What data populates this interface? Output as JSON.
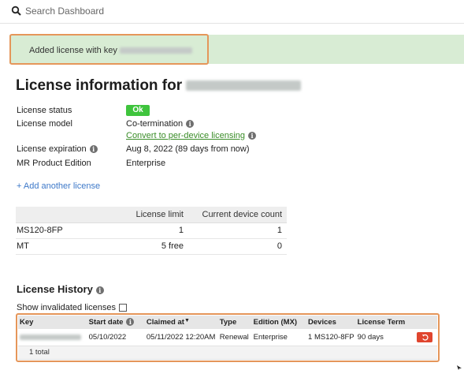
{
  "search": {
    "placeholder": "Search Dashboard",
    "icon": "search-icon"
  },
  "banner": {
    "text": "Added license with key ",
    "color": "#d8ecd4",
    "highlight_color": "#e5965a"
  },
  "page": {
    "title": "License information for "
  },
  "info": {
    "license_status_label": "License status",
    "license_status_value": "Ok",
    "license_model_label": "License model",
    "license_model_value": "Co-termination",
    "convert_link": "Convert to per-device licensing",
    "license_expiration_label": "License expiration",
    "license_expiration_value": "Aug 8, 2022 (89 days from now)",
    "mr_edition_label": "MR Product Edition",
    "mr_edition_value": "Enterprise"
  },
  "add_license": "+ Add another license",
  "limits": {
    "headers": [
      "",
      "License limit",
      "Current device count"
    ],
    "rows": [
      {
        "name": "MS120-8FP",
        "limit": "1",
        "count": "1"
      },
      {
        "name": "MT",
        "limit": "5 free",
        "count": "0"
      }
    ]
  },
  "history": {
    "title": "License History",
    "show_invalidated": "Show invalidated licenses",
    "headers": {
      "key": "Key",
      "start_date": "Start date",
      "claimed_at": "Claimed at",
      "type": "Type",
      "edition": "Edition (MX)",
      "devices": "Devices",
      "term": "License Term"
    },
    "rows": [
      {
        "start_date": "05/10/2022",
        "claimed_at": "05/11/2022 12:20AM",
        "type": "Renewal",
        "edition": "Enterprise",
        "devices": "1 MS120-8FP",
        "term": "90 days"
      }
    ],
    "total": "1 total"
  },
  "colors": {
    "ok_green": "#3fc43d",
    "link_green": "#3a8d28",
    "link_blue": "#3e79c9",
    "revert_red": "#e0452e"
  }
}
